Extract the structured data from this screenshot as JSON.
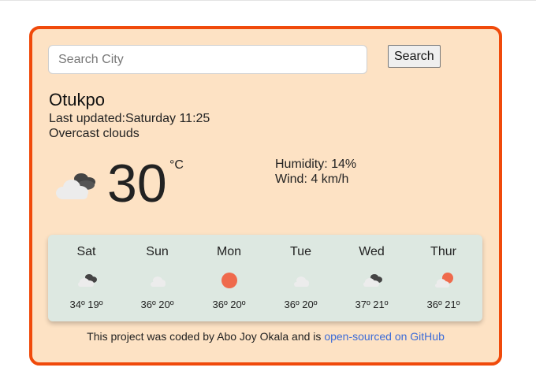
{
  "search": {
    "placeholder": "Search City",
    "button_label": "Search"
  },
  "current": {
    "city": "Otukpo",
    "last_updated": "Last updated:Saturday 11:25",
    "description": "Overcast clouds",
    "icon": "overcast-clouds-icon",
    "temperature": "30",
    "unit": "°C",
    "humidity": "Humidity: 14%",
    "wind": "Wind: 4 km/h"
  },
  "forecast": [
    {
      "day": "Sat",
      "icon": "overcast-clouds-icon",
      "temps": "34º 19º"
    },
    {
      "day": "Sun",
      "icon": "cloud-icon",
      "temps": "36º 20º"
    },
    {
      "day": "Mon",
      "icon": "sun-icon",
      "temps": "36º 20º"
    },
    {
      "day": "Tue",
      "icon": "cloud-icon",
      "temps": "36º 20º"
    },
    {
      "day": "Wed",
      "icon": "overcast-clouds-icon",
      "temps": "37º 21º"
    },
    {
      "day": "Thur",
      "icon": "partly-cloudy-icon",
      "temps": "36º 21º"
    }
  ],
  "footer": {
    "text": "This project was coded by Abo Joy Okala and is ",
    "link_text": "open-sourced on GitHub"
  },
  "colors": {
    "card_border": "#f04a0b",
    "card_background": "#fde2c4",
    "forecast_background": "#dde8e1",
    "sun": "#ef6a4c",
    "link": "#3b6bd8"
  }
}
